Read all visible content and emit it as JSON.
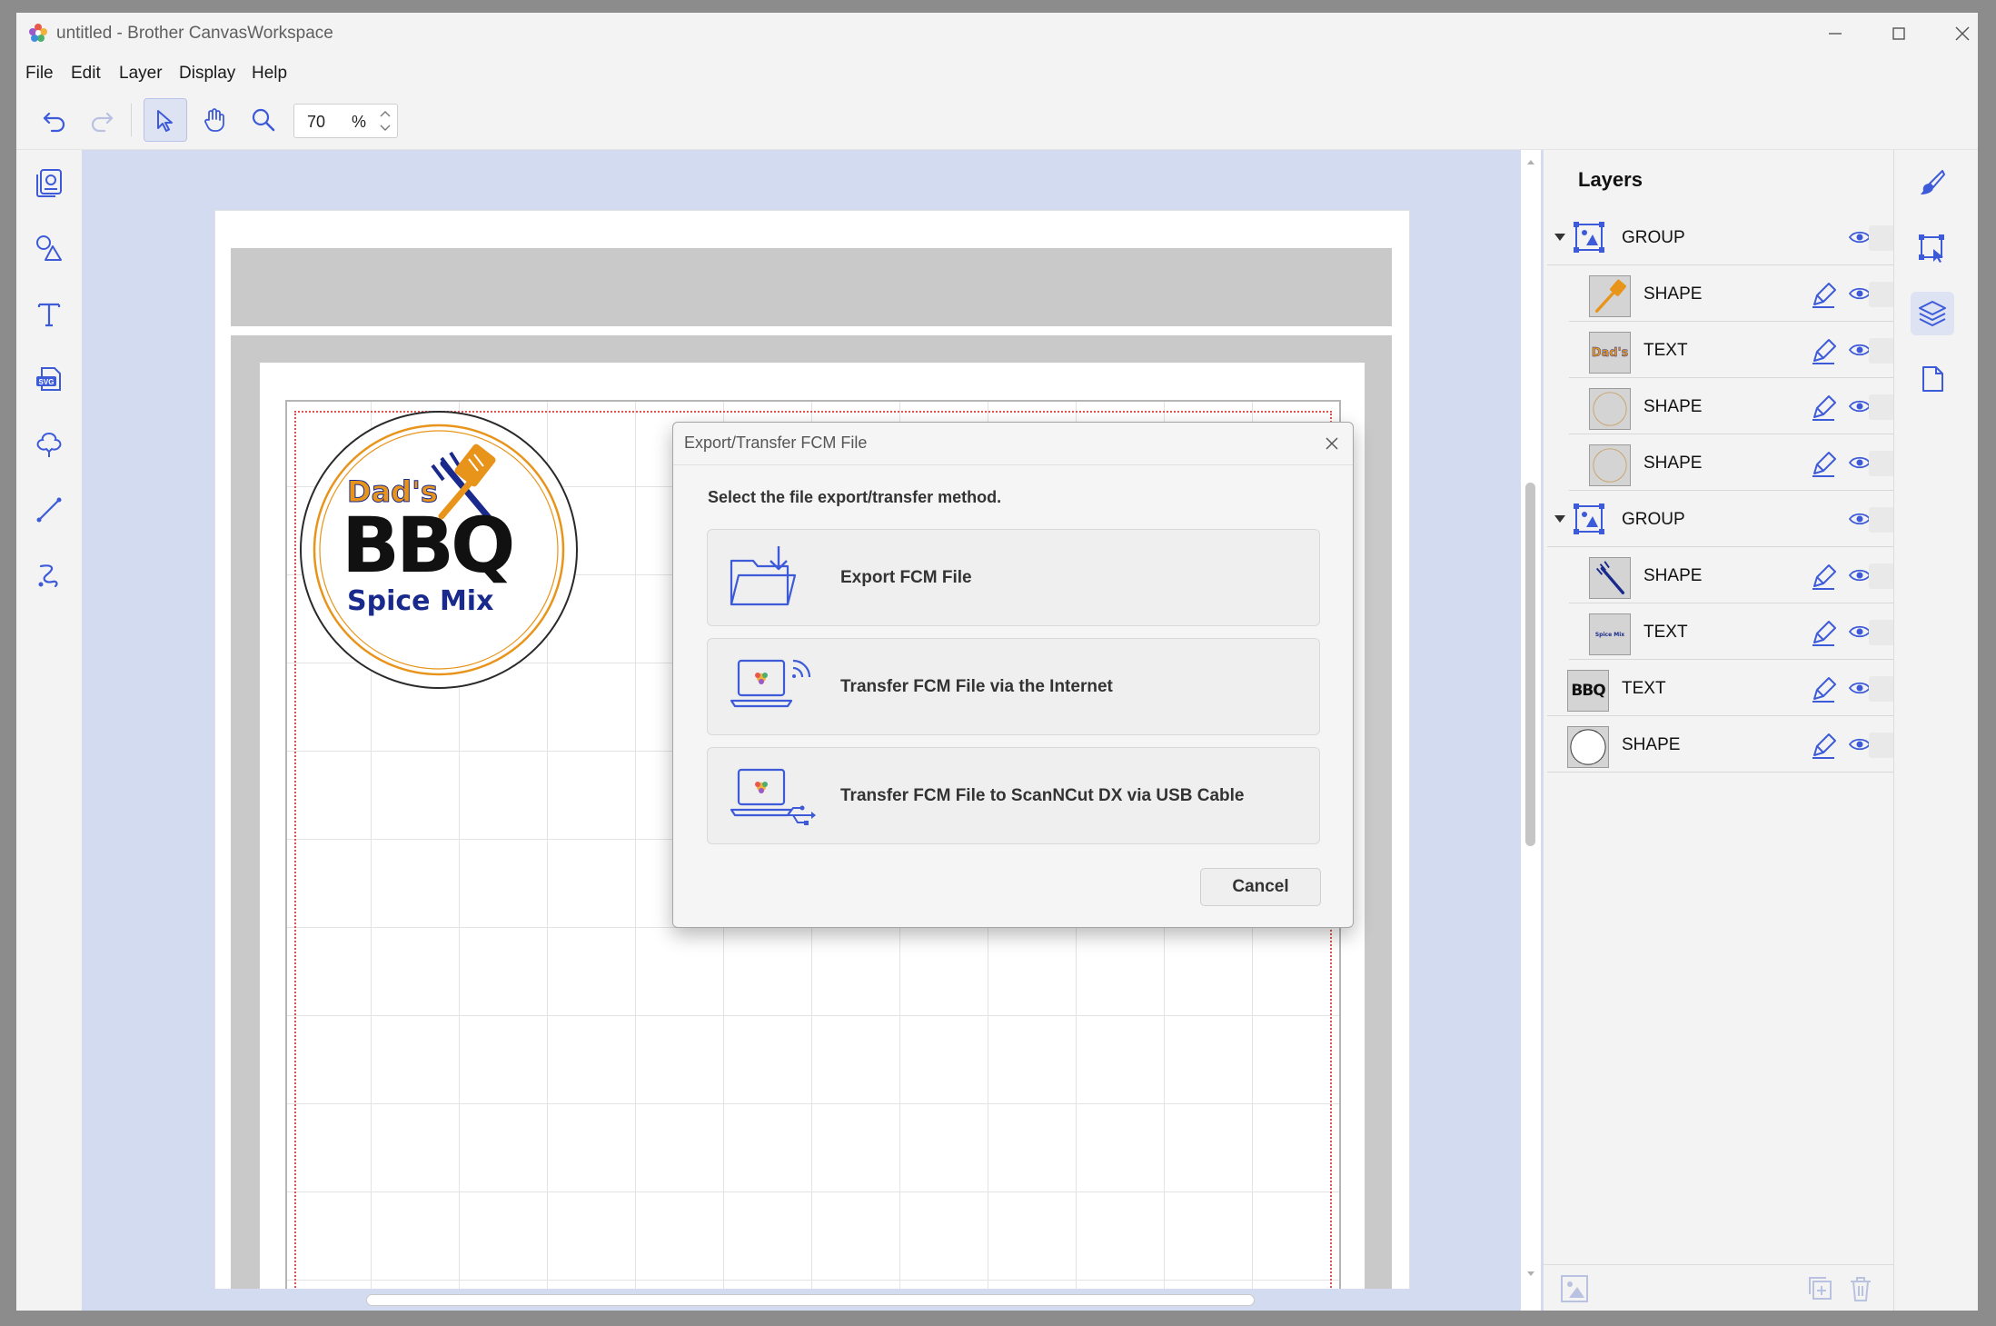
{
  "window": {
    "title": "untitled - Brother CanvasWorkspace"
  },
  "menu": [
    "File",
    "Edit",
    "Layer",
    "Display",
    "Help"
  ],
  "toolbar": {
    "zoom_value": "70",
    "zoom_unit": "%"
  },
  "layers": {
    "title": "Layers",
    "items": [
      {
        "label": "GROUP",
        "thumb": "group-icon"
      },
      {
        "label": "SHAPE",
        "thumb": "spatula-shape"
      },
      {
        "label": "TEXT",
        "thumb": "dads-text",
        "thumb_text": "Dad's"
      },
      {
        "label": "SHAPE",
        "thumb": "circle-shape"
      },
      {
        "label": "SHAPE",
        "thumb": "circle-shape"
      },
      {
        "label": "GROUP",
        "thumb": "group-icon"
      },
      {
        "label": "SHAPE",
        "thumb": "fork-shape"
      },
      {
        "label": "TEXT",
        "thumb": "spice-text",
        "thumb_text": "Spice Mix"
      },
      {
        "label": "TEXT",
        "thumb": "bbq-text",
        "thumb_text": "BBQ"
      },
      {
        "label": "SHAPE",
        "thumb": "outer-circle-shape"
      }
    ]
  },
  "canvas": {
    "logo": {
      "line1": "Dad's",
      "line2": "BBQ",
      "line3": "Spice Mix"
    }
  },
  "dialog": {
    "title": "Export/Transfer FCM File",
    "prompt": "Select the file export/transfer method.",
    "options": [
      {
        "label": "Export FCM File",
        "icon": "folder-download-icon"
      },
      {
        "label": "Transfer FCM File via the Internet",
        "icon": "laptop-wifi-icon"
      },
      {
        "label": "Transfer FCM File to ScanNCut DX via USB Cable",
        "icon": "laptop-usb-icon"
      }
    ],
    "cancel_label": "Cancel"
  },
  "colors": {
    "accent": "#3d5bd9",
    "canvas_bg": "#d3dbf1",
    "logo_orange": "#e8941a",
    "logo_navy": "#1a2a8c"
  }
}
